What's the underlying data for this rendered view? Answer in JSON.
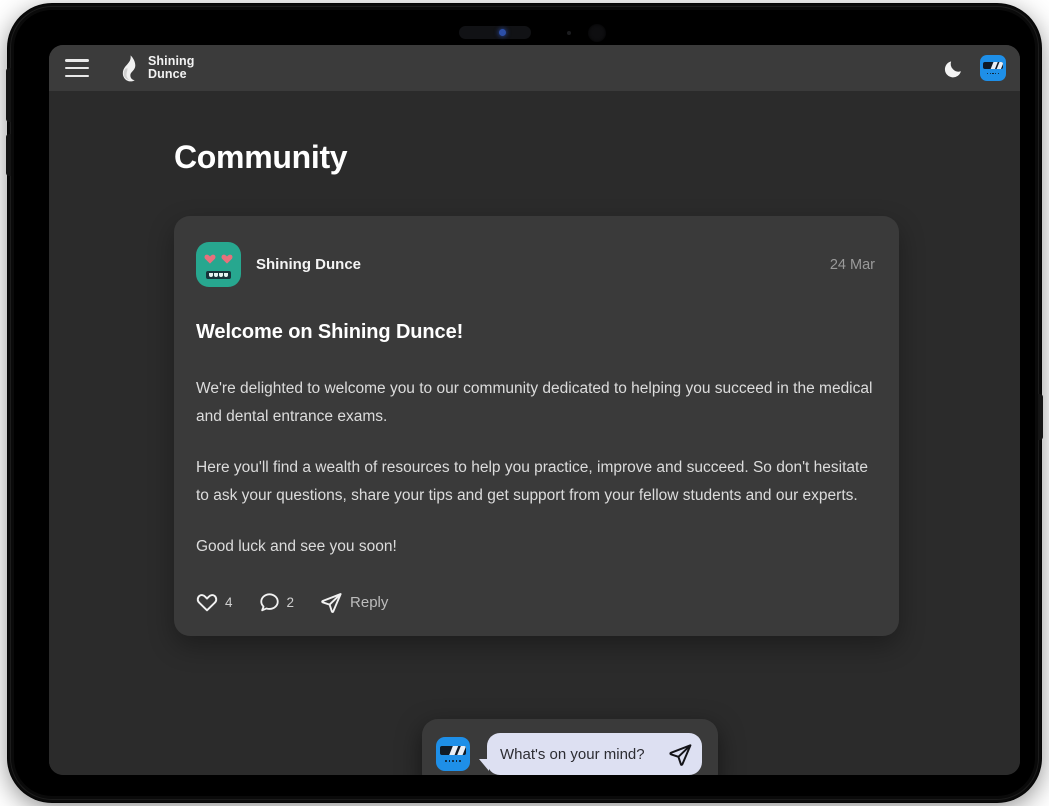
{
  "app": {
    "brand_line1": "Shining",
    "brand_line2": "Dunce",
    "menu_icon": "hamburger-menu-icon",
    "logo_icon": "flame-logo-icon",
    "theme_toggle_icon": "moon-icon",
    "user_avatar_icon": "robot-avatar-blue-icon"
  },
  "page": {
    "title": "Community"
  },
  "post": {
    "author": "Shining Dunce",
    "avatar_icon": "robot-avatar-teal-heart-eyes-icon",
    "date": "24 Mar",
    "title": "Welcome on Shining Dunce!",
    "paragraphs": [
      "We're delighted to welcome you to our community dedicated to helping you succeed in the medical and dental entrance exams.",
      "Here you'll find a wealth of resources to help you practice, improve and succeed. So don't hesitate to ask your questions, share your tips and get support from your fellow students and our experts.",
      "Good luck and see you soon!"
    ],
    "actions": {
      "like_icon": "heart-icon",
      "like_count": "4",
      "comment_icon": "speech-bubble-icon",
      "comment_count": "2",
      "reply_icon": "paper-plane-icon",
      "reply_label": "Reply"
    }
  },
  "composer": {
    "avatar_icon": "robot-avatar-blue-icon",
    "placeholder": "What's on your mind?",
    "value": "",
    "send_icon": "paper-plane-send-icon"
  },
  "colors": {
    "page_bg": "#2b2b2b",
    "card_bg": "#3a3a3a",
    "appbar_bg": "#3b3b3b",
    "accent_blue": "#1e8fe8",
    "avatar_teal": "#27a78f",
    "heart_pink": "#e8707c",
    "bubble_lavender": "#dde0f2"
  }
}
